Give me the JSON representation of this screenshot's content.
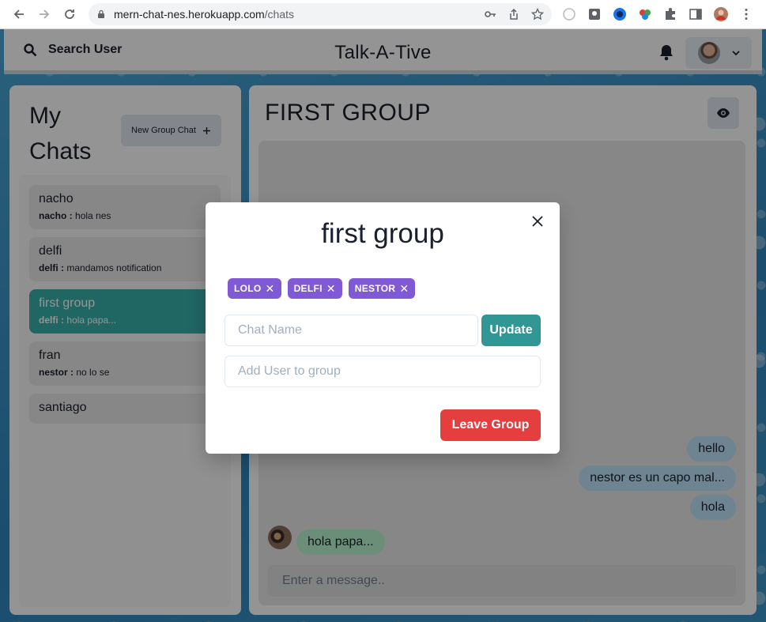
{
  "browser": {
    "url_host": "mern-chat-nes.herokuapp.com",
    "url_path": "/chats"
  },
  "header": {
    "search_label": "Search User",
    "app_title": "Talk-A-Tive"
  },
  "sidebar": {
    "title": "My Chats",
    "new_group_label": "New Group Chat",
    "chats": [
      {
        "name": "nacho",
        "sender": "nacho :",
        "message": "hola nes"
      },
      {
        "name": "delfi",
        "sender": "delfi :",
        "message": "mandamos notification"
      },
      {
        "name": "first group",
        "sender": "delfi :",
        "message": "hola papa..."
      },
      {
        "name": "fran",
        "sender": "nestor :",
        "message": "no lo se"
      },
      {
        "name": "santiago"
      }
    ]
  },
  "chat": {
    "heading": "FIRST GROUP",
    "messages": [
      "hello",
      "nestor es un capo mal...",
      "hola",
      "hola papa..."
    ],
    "input_placeholder": "Enter a message.."
  },
  "modal": {
    "title": "first group",
    "members": [
      "LOLO",
      "DELFI",
      "NESTOR"
    ],
    "chat_name_placeholder": "Chat Name",
    "update_label": "Update",
    "add_user_placeholder": "Add User to group",
    "leave_label": "Leave Group"
  },
  "colors": {
    "accent_teal": "#38b2ac",
    "badge_purple": "#805ad5",
    "leave_red": "#e53e3e"
  }
}
